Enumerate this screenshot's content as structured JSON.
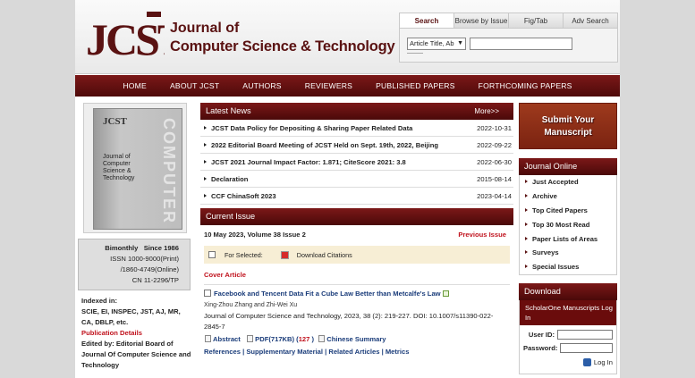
{
  "header": {
    "logo_text": "JCST",
    "title_line1": "Journal of",
    "title_line2": "Computer Science & Technology"
  },
  "search": {
    "tabs": [
      "Search",
      "Browse by Issue",
      "Fig/Tab",
      "Adv Search"
    ],
    "field_select": "Article Title, Ab",
    "query_value": ""
  },
  "nav": [
    "HOME",
    "ABOUT JCST",
    "AUTHORS",
    "REVIEWERS",
    "PUBLISHED PAPERS",
    "FORTHCOMING PAPERS"
  ],
  "sidebar_left": {
    "cover_alt": "JCST journal cover",
    "cover_title": "JCST",
    "cover_sub": "Journal of Computer Science & Technology",
    "cover_spine": "COMPUTER",
    "frequency": "Bimonthly",
    "since": "Since 1986",
    "issn_print": "ISSN 1000-9000(Print)",
    "issn_online": "/1860-4749(Online)",
    "cn": "CN 11-2296/TP",
    "indexed_label": "Indexed in:",
    "indexed_list": "SCIE, EI, INSPEC, JST, AJ, MR, CA, DBLP, etc.",
    "pub_details_label": "Publication Details",
    "edited_by_label": "Edited by:",
    "edited_by_value": "Editorial Board of Journal Of Computer Science and Technology"
  },
  "news": {
    "heading": "Latest News",
    "more_label": "More>>",
    "items": [
      {
        "title": "JCST Data Policy for Depositing & Sharing Paper Related Data",
        "date": "2022-10-31"
      },
      {
        "title": "2022 Editorial Board Meeting of JCST Held on Sept. 19th, 2022, Beijing",
        "date": "2022-09-22"
      },
      {
        "title": "JCST 2021 Journal Impact Factor: 1.871; CiteScore 2021: 3.8",
        "date": "2022-06-30"
      },
      {
        "title": "Declaration",
        "date": "2015-08-14"
      },
      {
        "title": "CCF ChinaSoft 2023",
        "date": "2023-04-14"
      }
    ]
  },
  "current_issue": {
    "heading": "Current Issue",
    "issue_info": "10 May 2023, Volume 38 Issue 2",
    "previous_label": "Previous Issue",
    "for_selected_label": "For Selected:",
    "download_citations_label": "Download Citations",
    "section_label": "Cover Article",
    "article": {
      "title": "Facebook and Tencent Data Fit a Cube Law Better than Metcalfe's Law",
      "authors": "Xing-Zhou Zhang and Zhi-Wei Xu",
      "citation": "Journal of Computer Science and Technology, 2023, 38 (2): 219-227.  DOI: 10.1007/s11390-022-2845-7",
      "abstract_label": "Abstract",
      "pdf_label": "PDF(717KB) (",
      "pdf_count": "127",
      "pdf_close": " )",
      "chinese_summary_label": "Chinese Summary",
      "references_label": "References",
      "supplementary_label": "Supplementary Material",
      "related_label": "Related Articles",
      "metrics_label": "Metrics",
      "sep": " | "
    }
  },
  "sidebar_right": {
    "submit_line1": "Submit Your",
    "submit_line2": "Manuscript",
    "journal_online_heading": "Journal Online",
    "journal_online_items": [
      "Just Accepted",
      "Archive",
      "Top Cited Papers",
      "Top 30 Most Read",
      "Paper Lists of Areas",
      "Surveys",
      "Special Issues"
    ],
    "download_heading": "Download",
    "scholarone_label": "ScholarOne Manuscripts Log In",
    "user_id_label": "User ID:",
    "password_label": "Password:",
    "login_label": "Log In"
  }
}
